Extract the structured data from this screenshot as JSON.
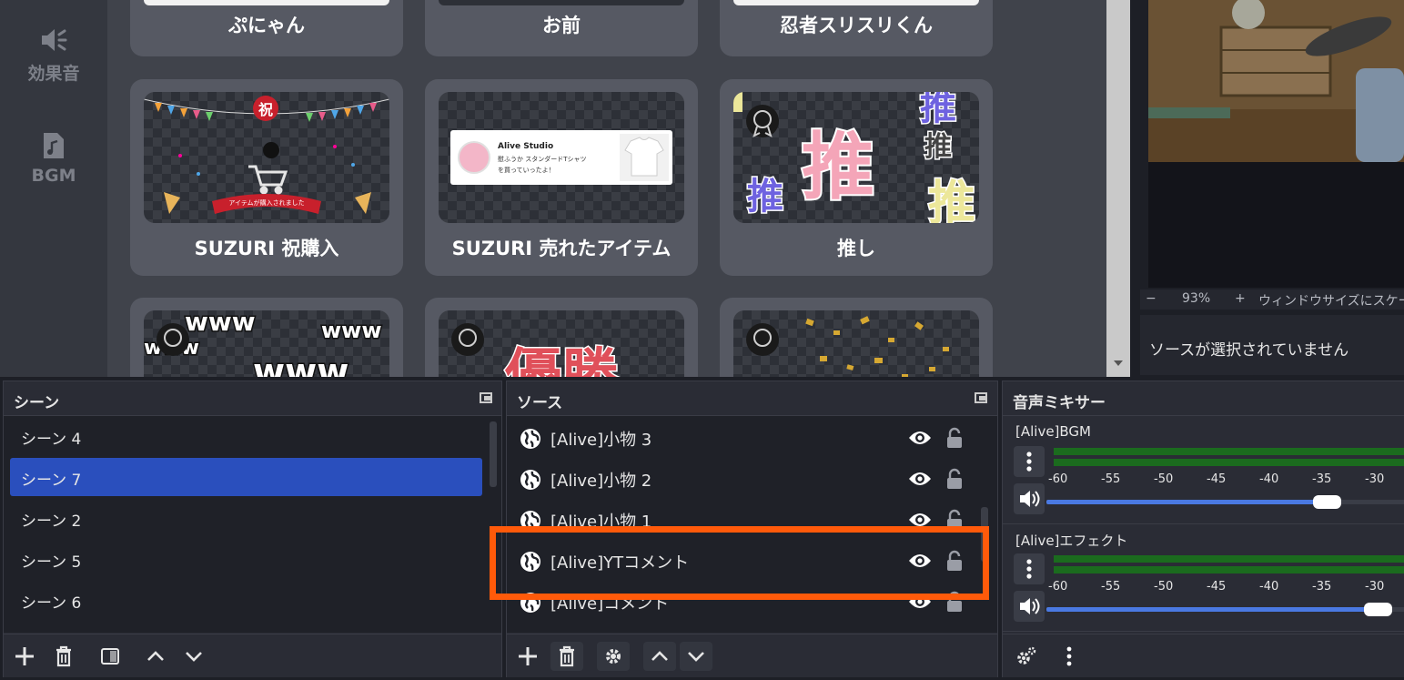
{
  "left_rail": {
    "items": [
      {
        "label": "効果音",
        "icon": "sound-effect-icon"
      },
      {
        "label": "BGM",
        "icon": "music-file-icon"
      }
    ]
  },
  "gallery": {
    "top_row": [
      "ぷにゃん",
      "お前",
      "忍者スリスリくん"
    ],
    "middle_row": [
      "SUZURI 祝購入",
      "SUZURI 売れたアイテム",
      "推し"
    ],
    "thumb_text": {
      "celebrate_badge": "祝",
      "ribbon": "アイテムが購入されました",
      "shop_name": "Alive Studio",
      "shop_line1": "慰ふうか スタンダードTシャツ",
      "shop_line2": "を買っていったよ！",
      "oshi": "推",
      "ww": "www",
      "yusho": "優勝"
    }
  },
  "preview": {
    "zoom_minus": "−",
    "zoom_value": "93%",
    "zoom_plus": "+",
    "zoom_mode": "ウィンドウサイズにスケール",
    "no_source": "ソースが選択されていません"
  },
  "scenes_dock": {
    "title": "シーン",
    "items": [
      "シーン 4",
      "シーン 7",
      "シーン 2",
      "シーン 5",
      "シーン 6"
    ],
    "selected_index": 1
  },
  "sources_dock": {
    "title": "ソース",
    "items": [
      "[Alive]小物 3",
      "[Alive]小物 2",
      "[Alive]小物 1",
      "[Alive]YTコメント",
      "[Alive]コメント"
    ],
    "highlighted": "[Alive]YTコメント"
  },
  "mixer_dock": {
    "title": "音声ミキサー",
    "channels": [
      {
        "name": "[Alive]BGM",
        "volume_fraction": 0.77
      },
      {
        "name": "[Alive]エフェクト",
        "volume_fraction": 0.91
      }
    ],
    "ticks": [
      "-60",
      "-55",
      "-50",
      "-45",
      "-40",
      "-35",
      "-30"
    ]
  },
  "colors": {
    "accent_blue": "#2a4fbd",
    "highlight_orange": "#ff5a0a",
    "meter_green": "#1b6b1e",
    "slider_blue": "#4a79e2"
  }
}
